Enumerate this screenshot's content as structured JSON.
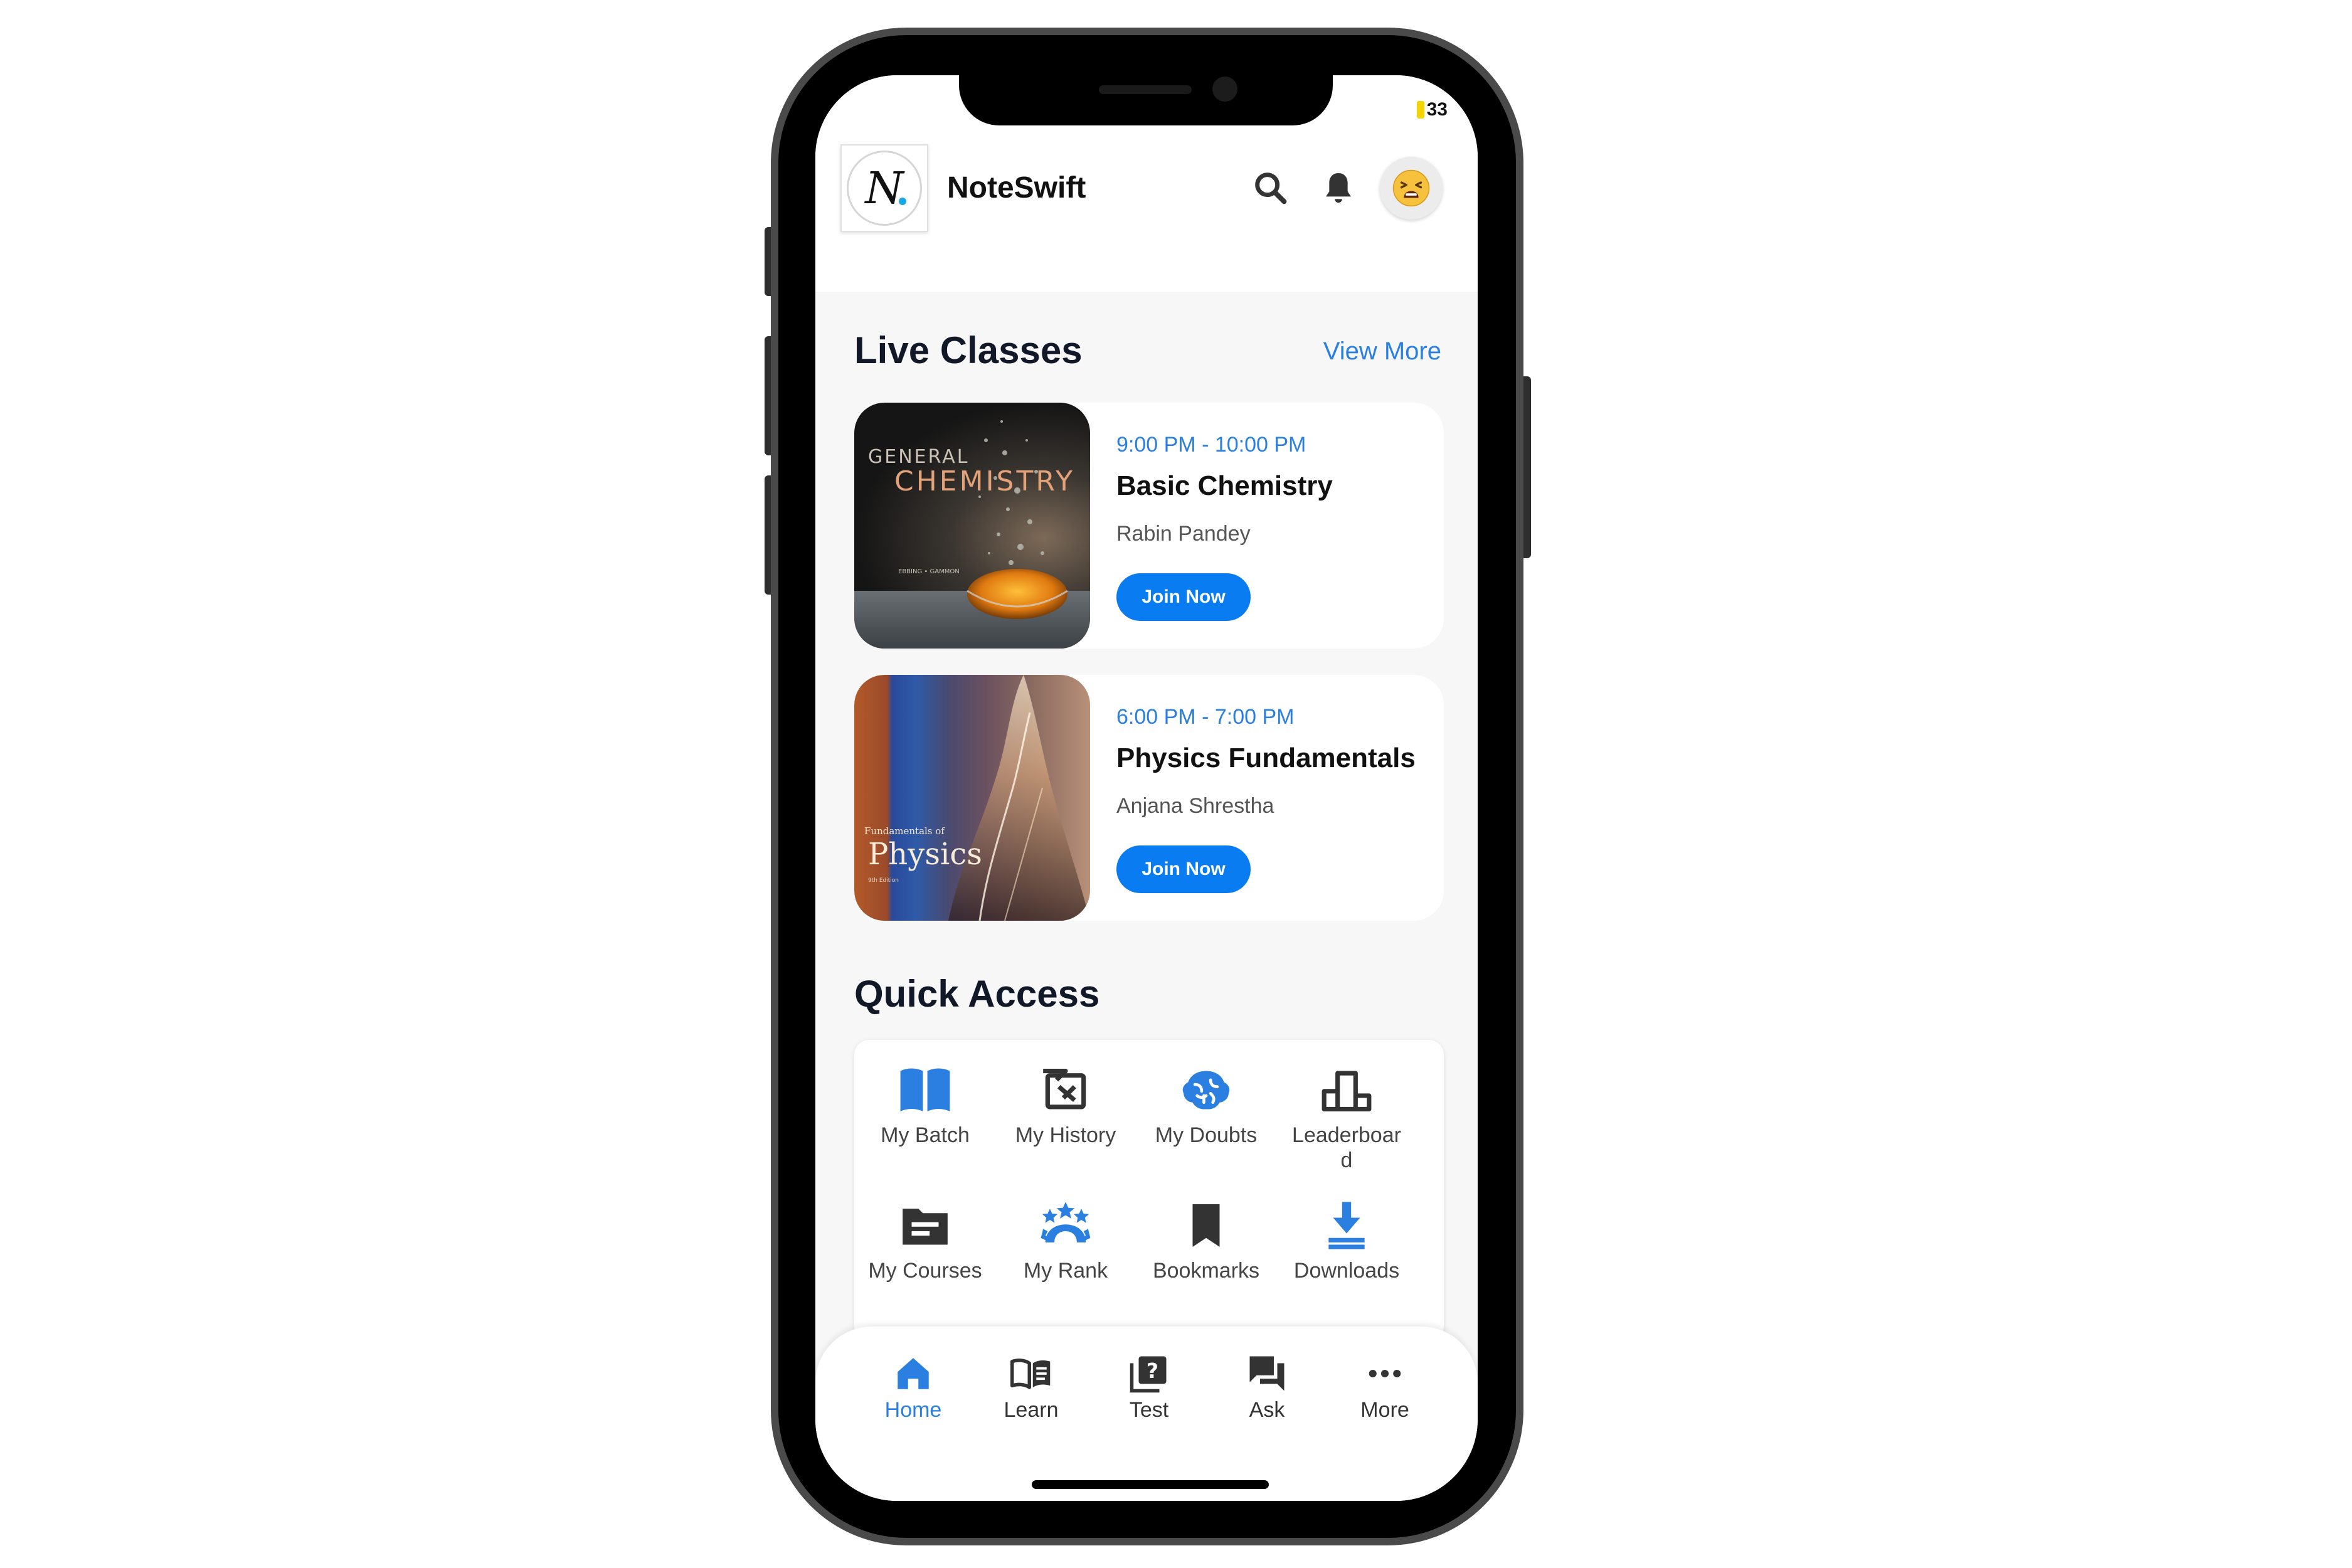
{
  "status": {
    "battery": "33"
  },
  "header": {
    "app_name": "NoteSwift",
    "logo_letter": "N"
  },
  "live_classes": {
    "title": "Live Classes",
    "view_more": "View More",
    "items": [
      {
        "time": "9:00 PM - 10:00 PM",
        "name": "Basic Chemistry",
        "teacher": "Rabin Pandey",
        "button": "Join Now",
        "cover_title_1": "GENERAL",
        "cover_title_2": "CHEMISTRY",
        "cover_authors": "EBBING • GAMMON"
      },
      {
        "time": "6:00 PM - 7:00 PM",
        "name": "Physics Fundamentals",
        "teacher": "Anjana Shrestha",
        "button": "Join Now",
        "cover_title_1": "Fundamentals of",
        "cover_title_2": "Physics",
        "cover_authors": "9th Edition"
      }
    ]
  },
  "quick_access": {
    "title": "Quick Access",
    "items": [
      {
        "label": "My Batch",
        "icon": "book-open-icon"
      },
      {
        "label": "My History",
        "icon": "history-icon"
      },
      {
        "label": "My Doubts",
        "icon": "brain-icon"
      },
      {
        "label": "Leaderboar\nd",
        "icon": "leaderboard-icon"
      },
      {
        "label": "My Courses",
        "icon": "folder-icon"
      },
      {
        "label": "My Rank",
        "icon": "rank-stars-icon"
      },
      {
        "label": "Bookmarks",
        "icon": "bookmark-icon"
      },
      {
        "label": "Downloads",
        "icon": "download-icon"
      }
    ]
  },
  "nav": {
    "items": [
      {
        "label": "Home",
        "icon": "home-icon",
        "active": true
      },
      {
        "label": "Learn",
        "icon": "book-icon",
        "active": false
      },
      {
        "label": "Test",
        "icon": "quiz-icon",
        "active": false
      },
      {
        "label": "Ask",
        "icon": "chat-icon",
        "active": false
      },
      {
        "label": "More",
        "icon": "more-icon",
        "active": false
      }
    ]
  },
  "colors": {
    "accent": "#2a7fe0",
    "button": "#0a7cf2",
    "background": "#f7f7f7"
  }
}
